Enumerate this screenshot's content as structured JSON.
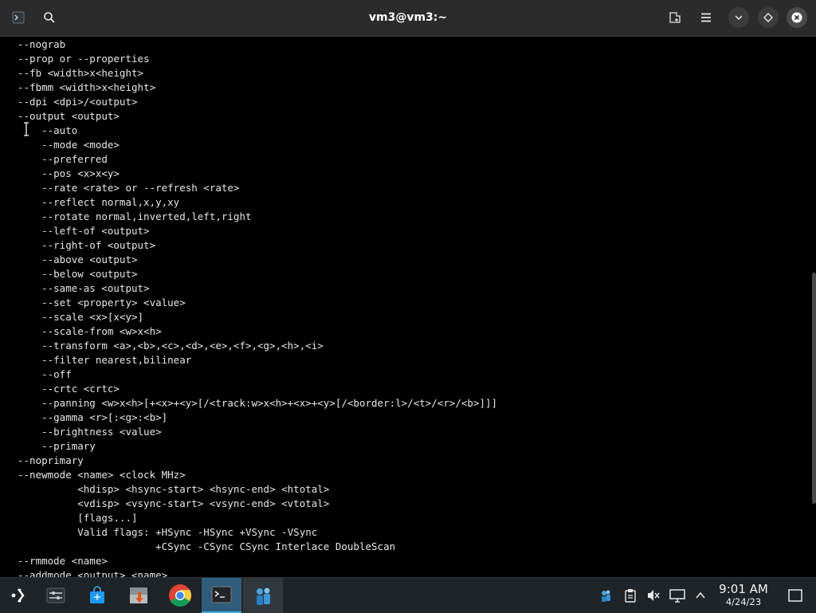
{
  "window": {
    "title": "vm3@vm3:~"
  },
  "terminal": {
    "lines": [
      "--nograb",
      "--prop or --properties",
      "--fb <width>x<height>",
      "--fbmm <width>x<height>",
      "--dpi <dpi>/<output>",
      "--output <output>",
      "    --auto",
      "    --mode <mode>",
      "    --preferred",
      "    --pos <x>x<y>",
      "    --rate <rate> or --refresh <rate>",
      "    --reflect normal,x,y,xy",
      "    --rotate normal,inverted,left,right",
      "    --left-of <output>",
      "    --right-of <output>",
      "    --above <output>",
      "    --below <output>",
      "    --same-as <output>",
      "    --set <property> <value>",
      "    --scale <x>[x<y>]",
      "    --scale-from <w>x<h>",
      "    --transform <a>,<b>,<c>,<d>,<e>,<f>,<g>,<h>,<i>",
      "    --filter nearest,bilinear",
      "    --off",
      "    --crtc <crtc>",
      "    --panning <w>x<h>[+<x>+<y>[/<track:w>x<h>+<x>+<y>[/<border:l>/<t>/<r>/<b>]]]",
      "    --gamma <r>[:<g>:<b>]",
      "    --brightness <value>",
      "    --primary",
      "--noprimary",
      "--newmode <name> <clock MHz>",
      "          <hdisp> <hsync-start> <hsync-end> <htotal>",
      "          <vdisp> <vsync-start> <vsync-end> <vtotal>",
      "          [flags...]",
      "          Valid flags: +HSync -HSync +VSync -VSync",
      "                       +CSync -CSync CSync Interlace DoubleScan",
      "--rmmode <name>",
      "--addmode <output> <name>"
    ]
  },
  "taskbar": {
    "clock": {
      "time": "9:01 AM",
      "date": "4/24/23"
    }
  },
  "icons": {
    "titlebar": [
      "terminal-app-icon",
      "search-icon",
      "new-tab-icon",
      "menu-icon",
      "minimize-icon",
      "maximize-icon",
      "close-icon"
    ],
    "taskbar": [
      "application-launcher-icon",
      "system-settings-icon",
      "discover-store-icon",
      "package-manager-icon",
      "chrome-icon",
      "terminal-icon",
      "network-app-icon"
    ],
    "tray": [
      "vm-tools-icon",
      "clipboard-icon",
      "volume-muted-icon",
      "display-icon",
      "tray-expand-icon",
      "show-desktop-icon"
    ]
  },
  "colors": {
    "titlebar_bg": "#2b2b2b",
    "terminal_bg": "#000000",
    "terminal_fg": "#e6e6e6",
    "taskbar_bg": "#1f2428",
    "accent": "#3daee9"
  }
}
